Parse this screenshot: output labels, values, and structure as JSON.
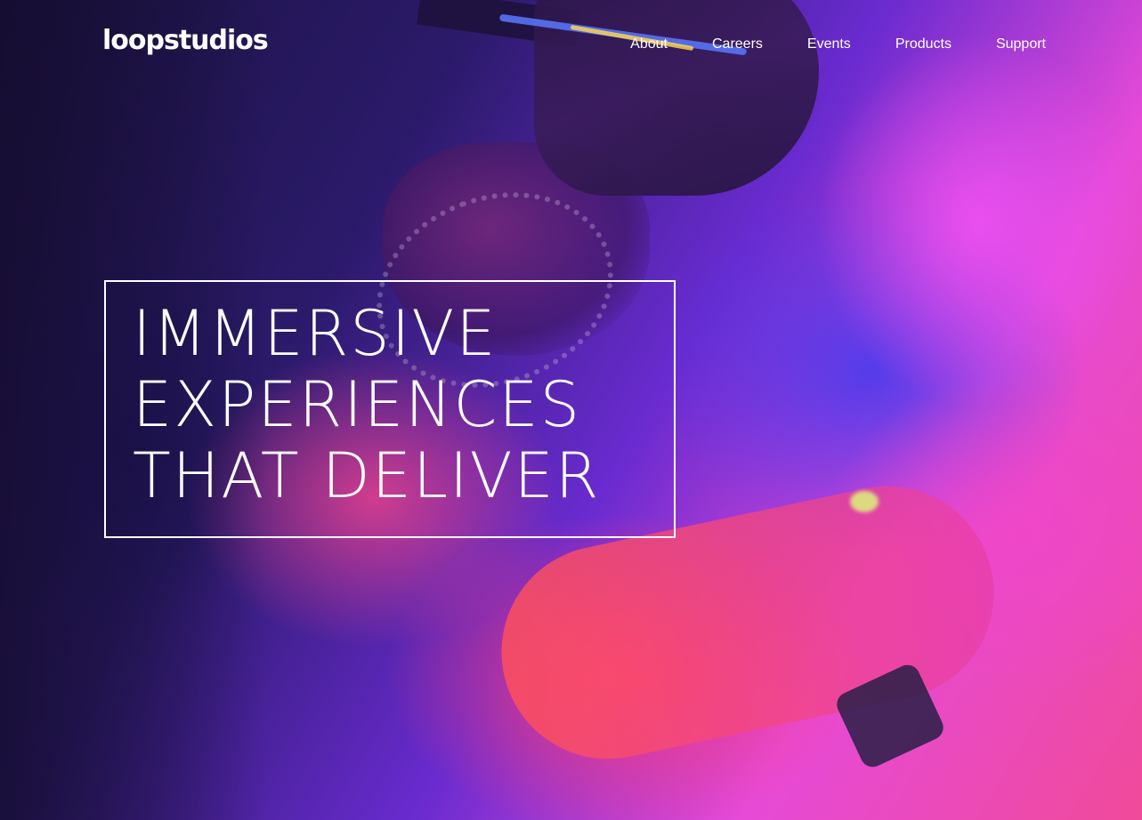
{
  "brand": {
    "logo_text": "loopstudios"
  },
  "nav": {
    "items": [
      {
        "label": "About"
      },
      {
        "label": "Careers"
      },
      {
        "label": "Events"
      },
      {
        "label": "Products"
      },
      {
        "label": "Support"
      }
    ]
  },
  "hero": {
    "headline_lines": [
      "IMMERSIVE",
      "EXPERIENCES",
      "THAT DELIVER"
    ]
  },
  "colors": {
    "text": "#ffffff",
    "accent_magenta": "#e64ad8",
    "accent_red": "#ff3c6e",
    "accent_blue": "#3c3cf0"
  }
}
